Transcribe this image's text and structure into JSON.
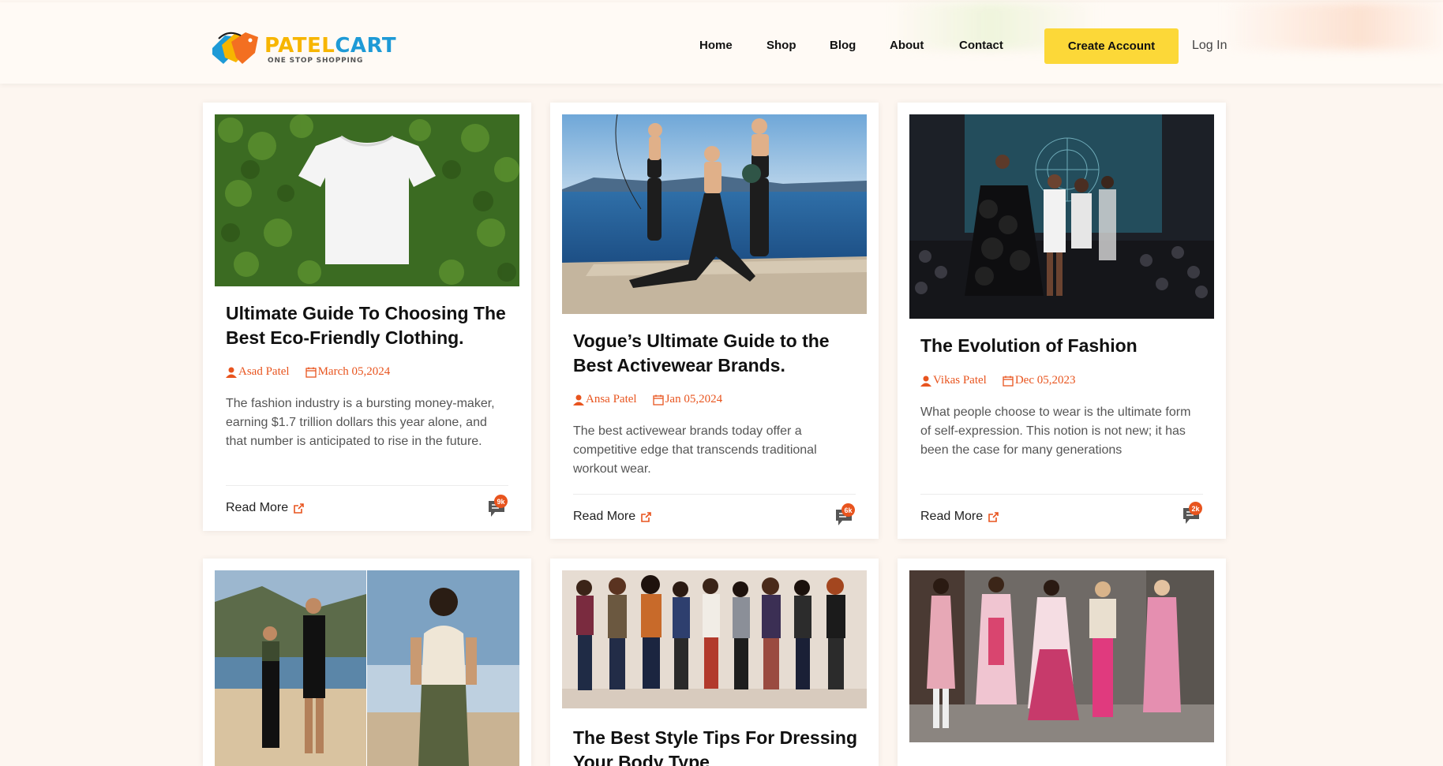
{
  "brand": {
    "name_part1": "PATEL",
    "name_part2": "CART",
    "tagline": "ONE STOP SHOPPING"
  },
  "nav": {
    "items": [
      {
        "label": "Home"
      },
      {
        "label": "Shop"
      },
      {
        "label": "Blog"
      },
      {
        "label": "About"
      },
      {
        "label": "Contact"
      }
    ],
    "create_account": "Create Account",
    "login": "Log In"
  },
  "colors": {
    "accent": "#e8541e",
    "button": "#fcd838",
    "page_bg": "#fdf6f0"
  },
  "posts": [
    {
      "title": "Ultimate Guide To Choosing The Best Eco-Friendly Clothing.",
      "author": "Asad Patel",
      "date": "March 05,2024",
      "excerpt": "The fashion industry is a bursting money-maker, earning $1.7 trillion dollars this year alone, and that number is anticipated to rise in the future.",
      "read_more": "Read More",
      "comments": "9k"
    },
    {
      "title": "Vogue’s Ultimate Guide to the Best Activewear Brands.",
      "author": "Ansa Patel",
      "date": "Jan 05,2024",
      "excerpt": "The best activewear brands today offer a competitive edge that transcends traditional workout wear.",
      "read_more": "Read More",
      "comments": "6k"
    },
    {
      "title": "The Evolution of Fashion",
      "author": "Vikas Patel",
      "date": "Dec 05,2023",
      "excerpt": "What people choose to wear is the ultimate form of self-expression. This notion is not new; it has been the case for many generations",
      "read_more": "Read More",
      "comments": "2k"
    },
    {
      "title": "",
      "author": "",
      "date": ""
    },
    {
      "title": "The Best Style Tips For Dressing Your Body Type",
      "author": "",
      "date": ""
    },
    {
      "title": "",
      "author": "",
      "date": ""
    }
  ]
}
